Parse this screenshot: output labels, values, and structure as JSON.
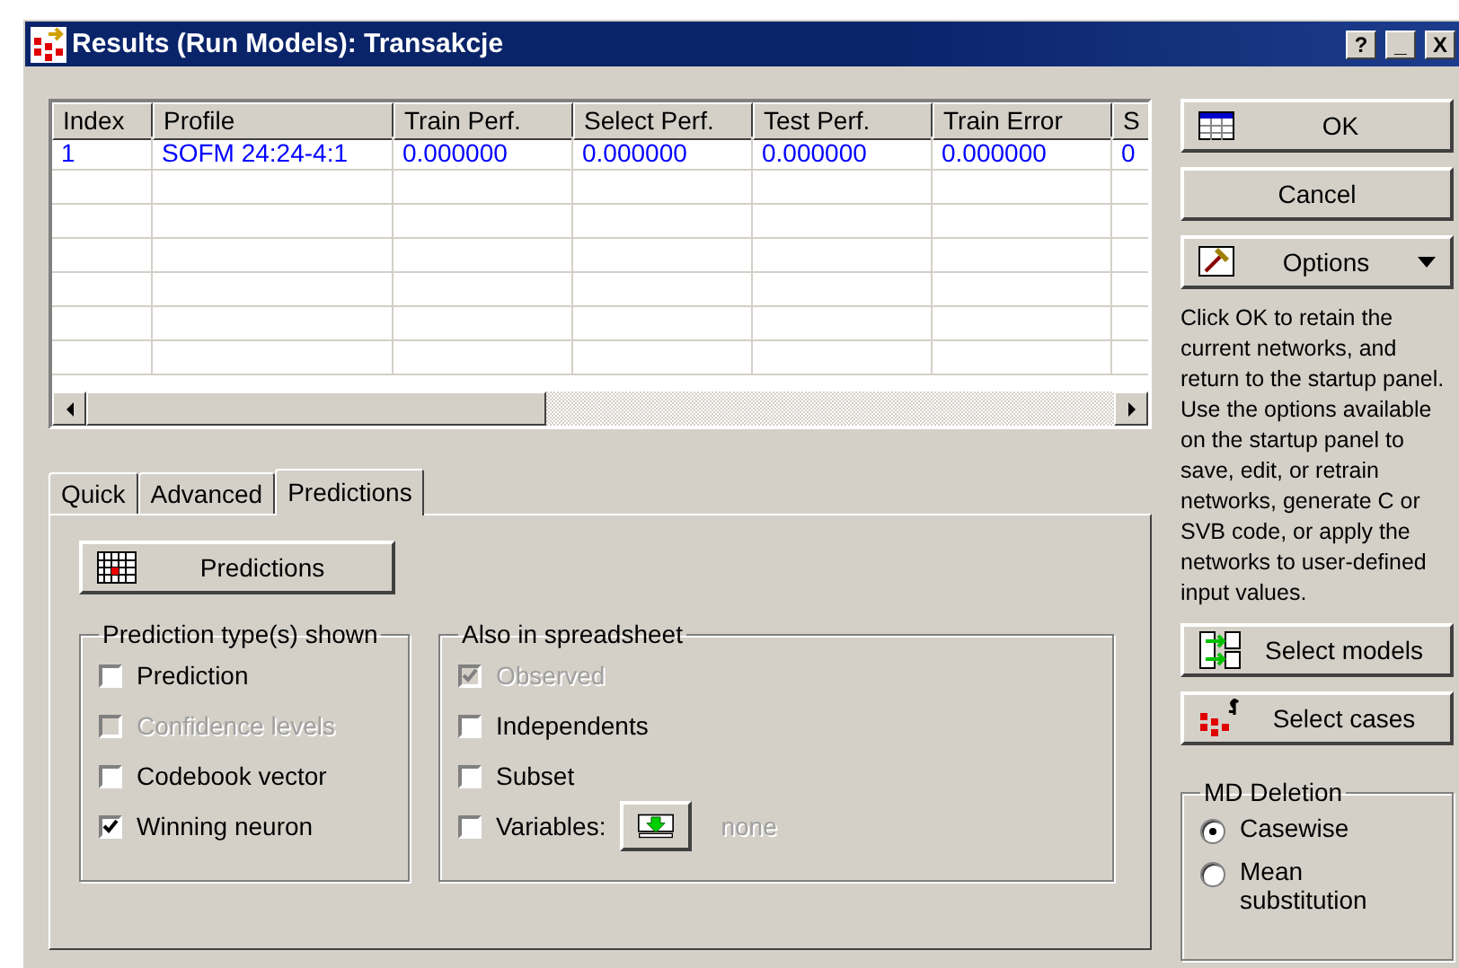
{
  "window": {
    "title": "Results (Run Models): Transakcje",
    "buttons": [
      "?",
      "_",
      "X"
    ]
  },
  "table": {
    "columns": [
      "Index",
      "Profile",
      "Train Perf.",
      "Select Perf.",
      "Test Perf.",
      "Train Error",
      "S"
    ],
    "rows": [
      [
        "1",
        "SOFM 24:24-4:1",
        "0.000000",
        "0.000000",
        "0.000000",
        "0.000000",
        "0"
      ]
    ]
  },
  "tabs": [
    {
      "label": "Quick",
      "selected": false
    },
    {
      "label": "Advanced",
      "selected": false
    },
    {
      "label": "Predictions",
      "selected": true
    }
  ],
  "predictions_button": "Predictions",
  "prediction_types": {
    "title": "Prediction type(s) shown",
    "items": [
      {
        "label": "Prediction",
        "checked": false,
        "disabled": false
      },
      {
        "label": "Confidence levels",
        "checked": false,
        "disabled": true
      },
      {
        "label": "Codebook vector",
        "checked": false,
        "disabled": false
      },
      {
        "label": "Winning neuron",
        "checked": true,
        "disabled": false
      }
    ]
  },
  "also_in_spreadsheet": {
    "title": "Also in spreadsheet",
    "items": [
      {
        "kind": "checkbox",
        "label": "Observed",
        "checked": true,
        "disabled": true
      },
      {
        "kind": "checkbox",
        "label": "Independents",
        "checked": false,
        "disabled": false
      },
      {
        "kind": "checkbox",
        "label": "Subset",
        "checked": false,
        "disabled": false
      },
      {
        "kind": "variables",
        "label": "Variables:",
        "checked": false,
        "disabled": false,
        "value": "none"
      }
    ]
  },
  "buttons": [
    {
      "kind": "ok",
      "label": "OK"
    },
    {
      "kind": "cancel",
      "label": "Cancel"
    },
    {
      "kind": "options",
      "label": "Options"
    }
  ],
  "hint": "Click OK to retain the current networks, and return to the startup panel. Use the options available on the startup panel to save, edit, or retrain networks, generate C or SVB code, or apply the networks to user-defined input values.",
  "action_buttons": [
    {
      "kind": "models",
      "label": "Select models"
    },
    {
      "kind": "cases",
      "label": "Select cases"
    }
  ],
  "md_deletion": {
    "title": "MD Deletion",
    "options": [
      {
        "label": "Casewise",
        "selected": true
      },
      {
        "label": "Mean substitution",
        "selected": false
      }
    ]
  }
}
